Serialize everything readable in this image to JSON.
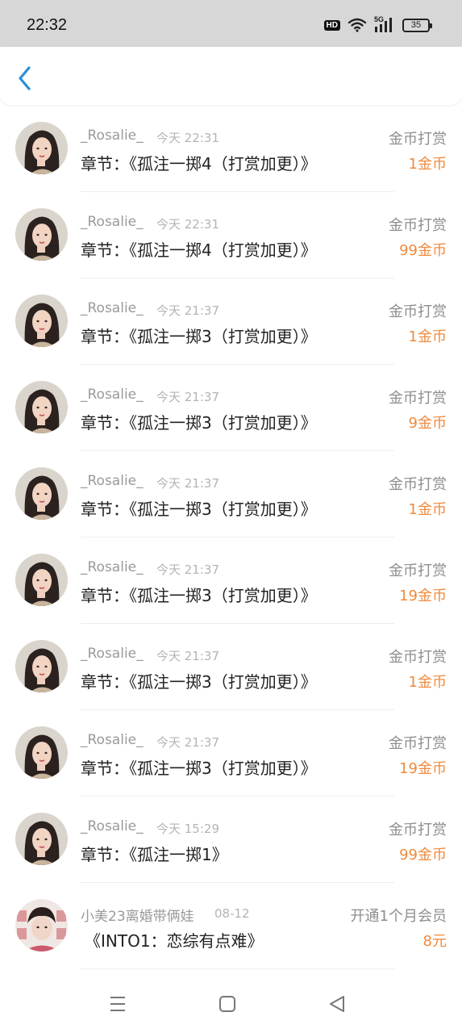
{
  "status_bar": {
    "time": "22:32",
    "hd": "HD",
    "network": "5G",
    "battery": "35"
  },
  "records": [
    {
      "username": "_Rosalie_",
      "time": "今天 22:31",
      "description": "章节：《孤注一掷4（打赏加更）》",
      "reward_type": "金币打赏",
      "amount": "1金币",
      "avatar": "girl"
    },
    {
      "username": "_Rosalie_",
      "time": "今天 22:31",
      "description": "章节：《孤注一掷4（打赏加更）》",
      "reward_type": "金币打赏",
      "amount": "99金币",
      "avatar": "girl"
    },
    {
      "username": "_Rosalie_",
      "time": "今天 21:37",
      "description": "章节：《孤注一掷3（打赏加更）》",
      "reward_type": "金币打赏",
      "amount": "1金币",
      "avatar": "girl"
    },
    {
      "username": "_Rosalie_",
      "time": "今天 21:37",
      "description": "章节：《孤注一掷3（打赏加更）》",
      "reward_type": "金币打赏",
      "amount": "9金币",
      "avatar": "girl"
    },
    {
      "username": "_Rosalie_",
      "time": "今天 21:37",
      "description": "章节：《孤注一掷3（打赏加更）》",
      "reward_type": "金币打赏",
      "amount": "1金币",
      "avatar": "girl"
    },
    {
      "username": "_Rosalie_",
      "time": "今天 21:37",
      "description": "章节：《孤注一掷3（打赏加更）》",
      "reward_type": "金币打赏",
      "amount": "19金币",
      "avatar": "girl"
    },
    {
      "username": "_Rosalie_",
      "time": "今天 21:37",
      "description": "章节：《孤注一掷3（打赏加更）》",
      "reward_type": "金币打赏",
      "amount": "1金币",
      "avatar": "girl"
    },
    {
      "username": "_Rosalie_",
      "time": "今天 21:37",
      "description": "章节：《孤注一掷3（打赏加更）》",
      "reward_type": "金币打赏",
      "amount": "19金币",
      "avatar": "girl"
    },
    {
      "username": "_Rosalie_",
      "time": "今天 15:29",
      "description": "章节：《孤注一掷1》",
      "reward_type": "金币打赏",
      "amount": "99金币",
      "avatar": "girl"
    },
    {
      "username": "小美23离婚带俩娃",
      "time": "08-12",
      "description": "《INTO1：恋综有点难》",
      "reward_type": "开通1个月会员",
      "amount": "8元",
      "avatar": "boy"
    }
  ],
  "colors": {
    "accent": "#2a8fd8",
    "amount": "#f08a3c",
    "status_bar_bg": "#d7d7d7"
  },
  "icons": {
    "back": "chevron-left-icon",
    "menu": "menu-icon",
    "home": "home-square-icon",
    "recent": "back-triangle-icon"
  }
}
